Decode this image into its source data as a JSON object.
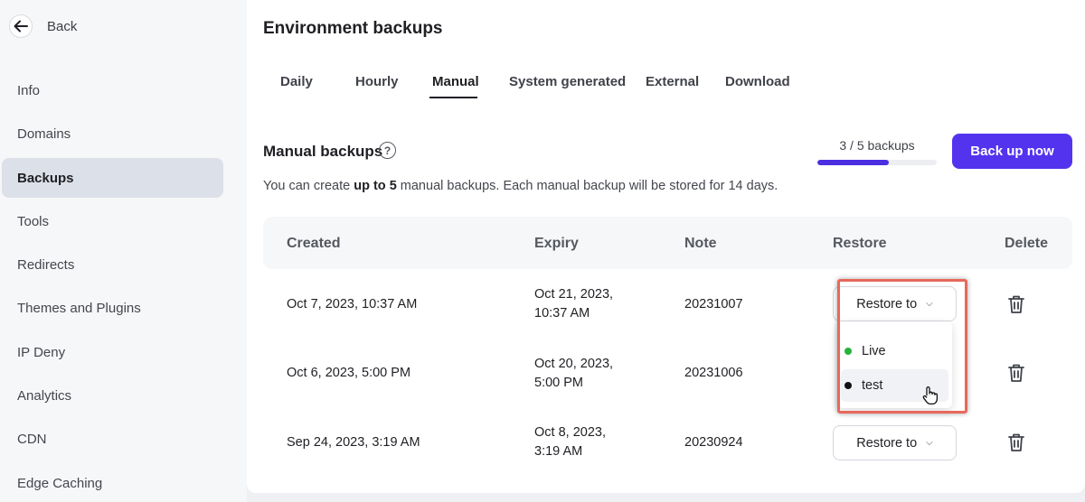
{
  "sidebar": {
    "back_label": "Back",
    "items": [
      {
        "label": "Info"
      },
      {
        "label": "Domains"
      },
      {
        "label": "Backups"
      },
      {
        "label": "Tools"
      },
      {
        "label": "Redirects"
      },
      {
        "label": "Themes and Plugins"
      },
      {
        "label": "IP Deny"
      },
      {
        "label": "Analytics"
      },
      {
        "label": "CDN"
      },
      {
        "label": "Edge Caching"
      }
    ],
    "active_item": "Backups"
  },
  "page": {
    "title": "Environment backups",
    "tabs": [
      {
        "label": "Daily"
      },
      {
        "label": "Hourly"
      },
      {
        "label": "Manual"
      },
      {
        "label": "System generated"
      },
      {
        "label": "External"
      },
      {
        "label": "Download"
      }
    ],
    "active_tab": "Manual"
  },
  "manual": {
    "title": "Manual backups",
    "help_glyph": "?",
    "usage_label": "3 / 5 backups",
    "usage_fraction": 0.6,
    "backup_button": "Back up now",
    "desc_pre": "You can create ",
    "desc_bold": "up to 5",
    "desc_post": " manual backups. Each manual backup will be stored for 14 days."
  },
  "table": {
    "headers": {
      "created": "Created",
      "expiry": "Expiry",
      "note": "Note",
      "restore": "Restore",
      "delete": "Delete"
    },
    "rows": [
      {
        "created": "Oct 7, 2023, 10:37 AM",
        "expiry": "Oct 21, 2023, 10:37 AM",
        "note": "20231007",
        "restore": "Restore to"
      },
      {
        "created": "Oct 6, 2023, 5:00 PM",
        "expiry": "Oct 20, 2023, 5:00 PM",
        "note": "20231006",
        "restore": "Restore to"
      },
      {
        "created": "Sep 24, 2023, 3:19 AM",
        "expiry": "Oct 8, 2023, 3:19 AM",
        "note": "20230924",
        "restore": "Restore to"
      }
    ]
  },
  "restore_dropdown": {
    "options": [
      {
        "label": "Live",
        "dot_color": "#27b33a"
      },
      {
        "label": "test",
        "dot_color": "#111111"
      }
    ],
    "hovered": "test"
  },
  "colors": {
    "accent": "#5333ed",
    "highlight": "#e8685c",
    "active_nav": "#dce0e8"
  },
  "icons": {
    "back": "arrow-left-icon",
    "help": "question-circle-icon",
    "dropdown": "chevron-down-icon",
    "delete": "trash-icon",
    "cursor": "hand-pointer-icon"
  }
}
